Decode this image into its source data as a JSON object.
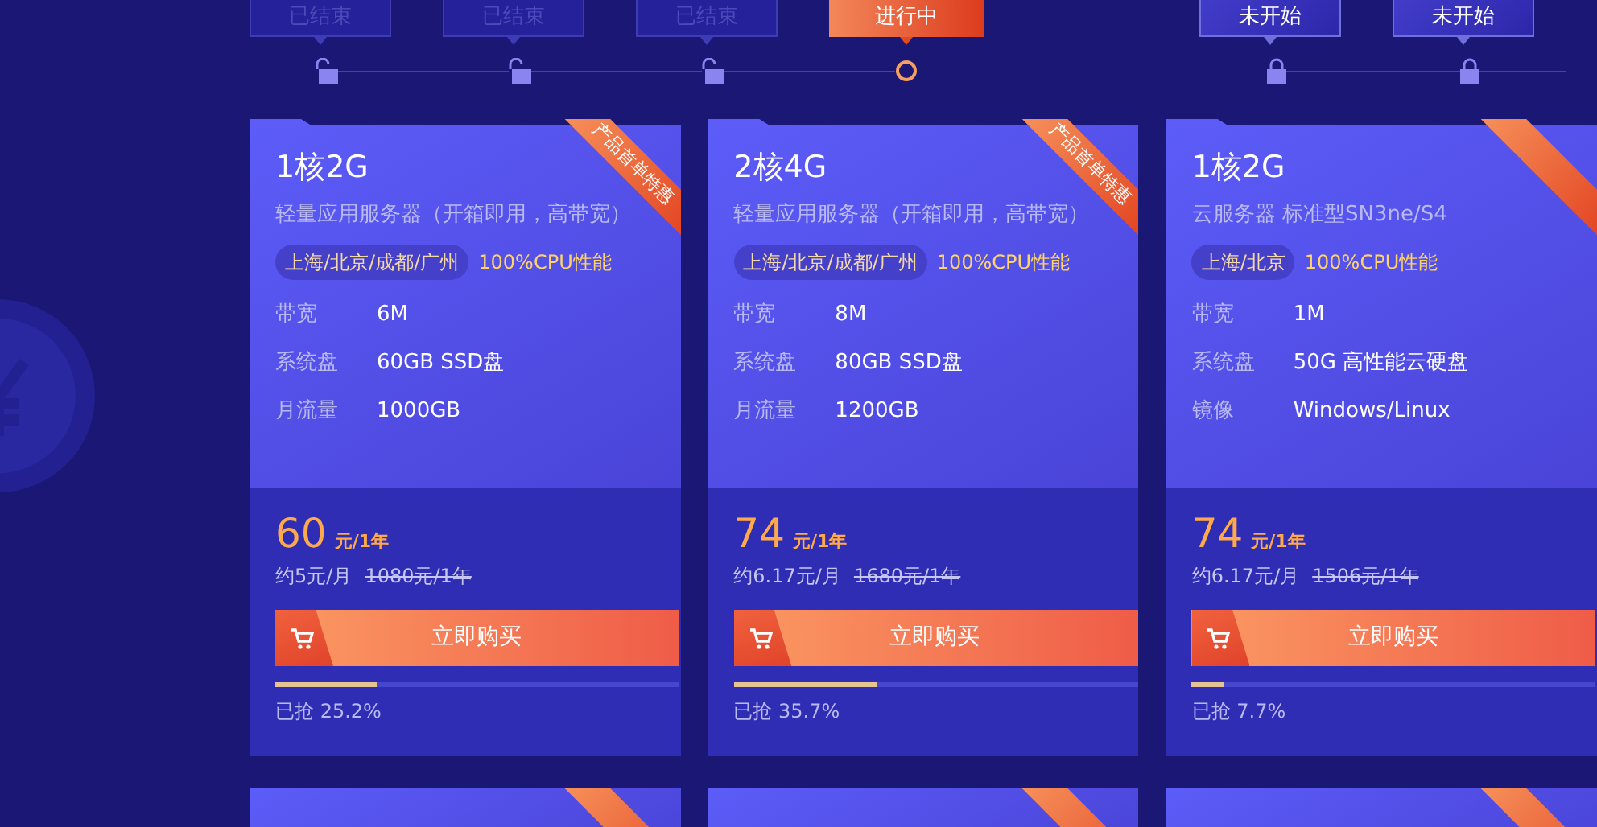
{
  "timeline": [
    {
      "label": "已结束",
      "ended": true,
      "selected": false
    },
    {
      "label": "已结束",
      "ended": true,
      "selected": false
    },
    {
      "label": "已结束",
      "ended": true,
      "selected": false
    },
    {
      "label": "进行中",
      "ended": false,
      "selected": true
    },
    {
      "label": "未开始",
      "ended": false,
      "selected": false
    },
    {
      "label": "未开始",
      "ended": false,
      "selected": false
    }
  ],
  "products": [
    {
      "title": "1核2G",
      "subtitle": "轻量应用服务器（开箱即用，高带宽）",
      "regions": "上海/北京/成都/广州",
      "performance": "100%CPU性能",
      "specs": [
        {
          "label": "带宽",
          "value": "6M"
        },
        {
          "label": "系统盘",
          "value": "60GB SSD盘"
        },
        {
          "label": "月流量",
          "value": "1000GB"
        }
      ],
      "ribbon": true,
      "badge": "产品首单特惠",
      "price": "60",
      "price_unit": "元/1年",
      "monthly": "约5元/月",
      "original_price": "1080元/1年",
      "buy_label": "立即购买",
      "sold_text": "已抢 25.2%",
      "level": 0.252
    },
    {
      "title": "2核4G",
      "subtitle": "轻量应用服务器（开箱即用，高带宽）",
      "regions": "上海/北京/成都/广州",
      "performance": "100%CPU性能",
      "specs": [
        {
          "label": "带宽",
          "value": "8M"
        },
        {
          "label": "系统盘",
          "value": "80GB SSD盘"
        },
        {
          "label": "月流量",
          "value": "1200GB"
        }
      ],
      "ribbon": true,
      "badge": "产品首单特惠",
      "price": "74",
      "price_unit": "元/1年",
      "monthly": "约6.17元/月",
      "original_price": "1680元/1年",
      "buy_label": "立即购买",
      "sold_text": "已抢 35.7%",
      "level": 0.357
    },
    {
      "title": "1核2G",
      "subtitle": "云服务器 标准型SN3ne/S4",
      "regions": "上海/北京",
      "performance": "100%CPU性能",
      "specs": [
        {
          "label": "带宽",
          "value": "1M"
        },
        {
          "label": "系统盘",
          "value": "50G 高性能云硬盘"
        },
        {
          "label": "镜像",
          "value": "Windows/Linux"
        }
      ],
      "ribbon": true,
      "price": "74",
      "price_unit": "元/1年",
      "monthly": "约6.17元/月",
      "original_price": "1506元/1年",
      "buy_label": "立即购买",
      "sold_text": "已抢 7.7%",
      "level": 0.077
    }
  ],
  "next_row_cards": [
    {
      "ribbon": true
    },
    {
      "ribbon": true
    },
    {
      "ribbon": true
    }
  ]
}
